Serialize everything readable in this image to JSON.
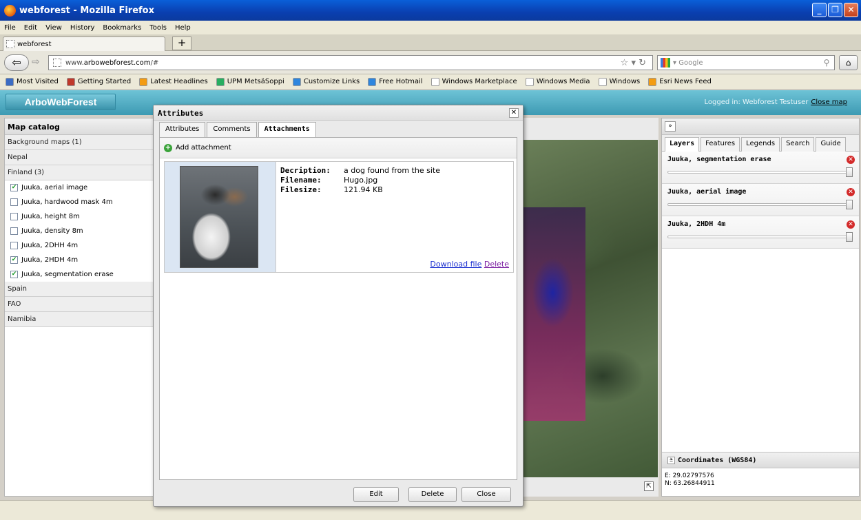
{
  "window": {
    "title": "webforest - Mozilla Firefox"
  },
  "menu": [
    "File",
    "Edit",
    "View",
    "History",
    "Bookmarks",
    "Tools",
    "Help"
  ],
  "tab": {
    "label": "webforest",
    "new_tab": "+"
  },
  "nav": {
    "url_prefix": "www.",
    "url_host": "arbowebforest.com",
    "url_suffix": "/#",
    "search_placeholder": "Google"
  },
  "bookmarks": [
    {
      "label": "Most Visited",
      "color": "#3b6cc4"
    },
    {
      "label": "Getting Started",
      "color": "#c0392b"
    },
    {
      "label": "Latest Headlines",
      "color": "#f39c12"
    },
    {
      "label": "UPM MetsäSoppi",
      "color": "#27ae60"
    },
    {
      "label": "Customize Links",
      "color": "#2e86de"
    },
    {
      "label": "Free Hotmail",
      "color": "#2e86de"
    },
    {
      "label": "Windows Marketplace",
      "color": "#ffffff"
    },
    {
      "label": "Windows Media",
      "color": "#ffffff"
    },
    {
      "label": "Windows",
      "color": "#ffffff"
    },
    {
      "label": "Esri News Feed",
      "color": "#f39c12"
    }
  ],
  "app": {
    "brand": "ArboWebForest",
    "logged_in": "Logged in: Webforest Testuser",
    "close_map": "Close map"
  },
  "catalog": {
    "title": "Map catalog",
    "collapse": "«",
    "groups_top": [
      "Background maps (1)",
      "Nepal",
      "Finland (3)"
    ],
    "items": [
      {
        "label": "Juuka, aerial image",
        "checked": true
      },
      {
        "label": "Juuka, hardwood mask 4m",
        "checked": false
      },
      {
        "label": "Juuka, height 8m",
        "checked": false
      },
      {
        "label": "Juuka, density 8m",
        "checked": false
      },
      {
        "label": "Juuka, 2DHH 4m",
        "checked": false
      },
      {
        "label": "Juuka, 2HDH 4m",
        "checked": true
      },
      {
        "label": "Juuka, segmentation erase",
        "checked": true
      }
    ],
    "groups_bottom": [
      "Spain",
      "FAO",
      "Namibia"
    ]
  },
  "right": {
    "collapse": "»",
    "tabs": [
      "Layers",
      "Features",
      "Legends",
      "Search",
      "Guide"
    ],
    "active_tab": "Layers",
    "layers": [
      {
        "name": "Juuka, segmentation erase",
        "opacity": 1.0
      },
      {
        "name": "Juuka, aerial image",
        "opacity": 1.0
      },
      {
        "name": "Juuka, 2HDH 4m",
        "opacity": 1.0
      }
    ],
    "coords_title": "Coordinates (WGS84)",
    "coord_e": "E: 29.02797576",
    "coord_n": "N: 63.26844911"
  },
  "dialog": {
    "title": "Attributes",
    "tabs": [
      "Attributes",
      "Comments",
      "Attachments"
    ],
    "active_tab": "Attachments",
    "add_label": "Add attachment",
    "attachment": {
      "desc_label": "Decription:",
      "desc_value": "a dog found from the site",
      "file_label": "Filename:",
      "file_value": "Hugo.jpg",
      "size_label": "Filesize:",
      "size_value": "121.94 KB",
      "download": "Download file",
      "delete": "Delete"
    },
    "buttons": {
      "edit": "Edit",
      "delete": "Delete",
      "close": "Close"
    }
  }
}
